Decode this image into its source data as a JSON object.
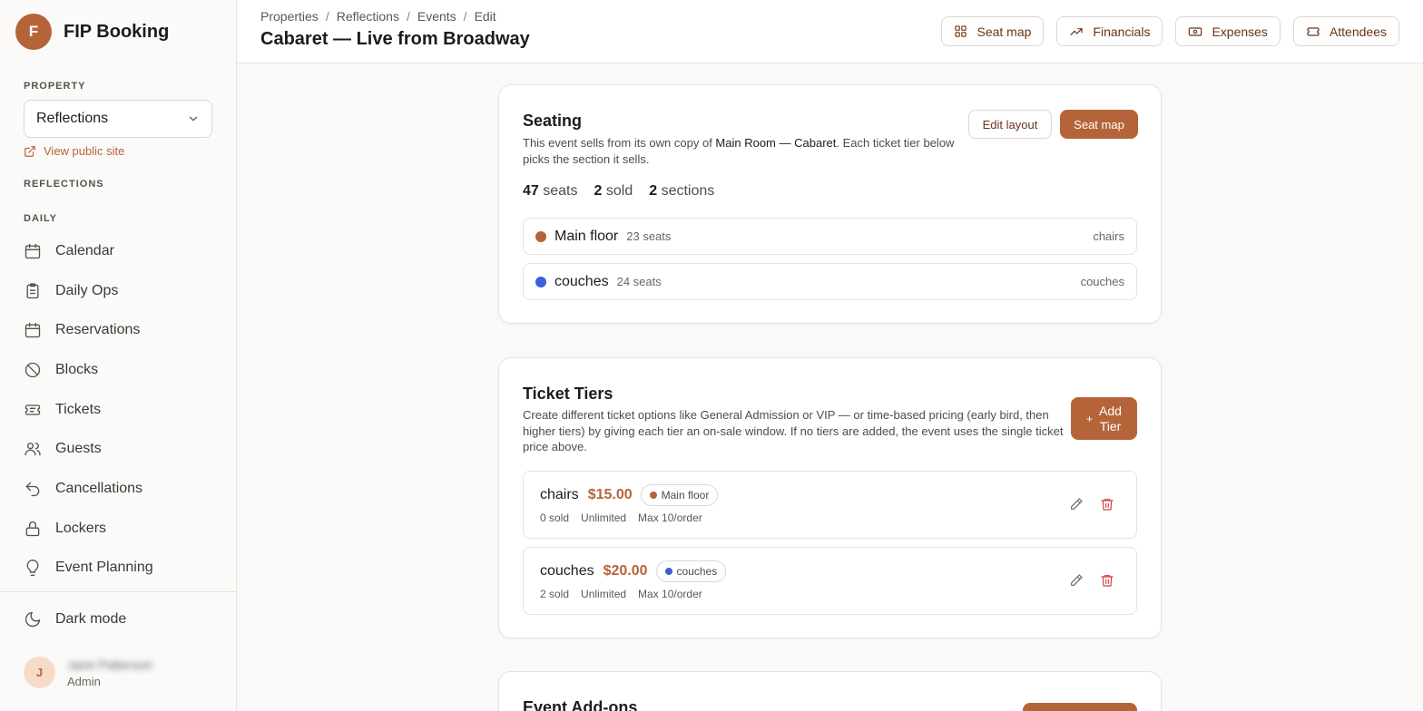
{
  "brand": {
    "initial": "F",
    "name": "FIP Booking"
  },
  "sidebar": {
    "property_label": "PROPERTY",
    "property_value": "Reflections",
    "public_link": "View public site",
    "group_label": "REFLECTIONS",
    "daily_label": "DAILY",
    "items": [
      {
        "label": "Calendar",
        "icon": "calendar-icon"
      },
      {
        "label": "Daily Ops",
        "icon": "clipboard-icon"
      },
      {
        "label": "Reservations",
        "icon": "calendar-icon"
      },
      {
        "label": "Blocks",
        "icon": "ban-icon"
      },
      {
        "label": "Tickets",
        "icon": "ticket-icon"
      },
      {
        "label": "Guests",
        "icon": "users-icon"
      },
      {
        "label": "Cancellations",
        "icon": "undo-icon"
      },
      {
        "label": "Lockers",
        "icon": "lock-icon"
      },
      {
        "label": "Event Planning",
        "icon": "lightbulb-icon"
      }
    ],
    "dark_mode": "Dark mode",
    "user": {
      "initial": "J",
      "name": "Jane Patterson",
      "role": "Admin"
    }
  },
  "header": {
    "breadcrumbs": [
      "Properties",
      "Reflections",
      "Events",
      "Edit"
    ],
    "title": "Cabaret — Live from Broadway",
    "actions": [
      {
        "label": "Seat map",
        "icon": "grid-icon"
      },
      {
        "label": "Financials",
        "icon": "trend-up-icon"
      },
      {
        "label": "Expenses",
        "icon": "banknote-icon"
      },
      {
        "label": "Attendees",
        "icon": "ticket-icon"
      }
    ]
  },
  "seating": {
    "title": "Seating",
    "desc_pre": "This event sells from its own copy of ",
    "desc_bold": "Main Room — Cabaret",
    "desc_post": ". Each ticket tier below picks the section it sells.",
    "edit_layout": "Edit layout",
    "seat_map": "Seat map",
    "stats": [
      {
        "value": "47",
        "label": "seats"
      },
      {
        "value": "2",
        "label": "sold"
      },
      {
        "value": "2",
        "label": "sections"
      }
    ],
    "sections": [
      {
        "name": "Main floor",
        "seats": "23 seats",
        "type": "chairs",
        "color": "#b5643a"
      },
      {
        "name": "couches",
        "seats": "24 seats",
        "type": "couches",
        "color": "#3b5fd6"
      }
    ]
  },
  "tiers": {
    "title": "Ticket Tiers",
    "desc": "Create different ticket options like General Admission or VIP — or time-based pricing (early bird, then higher tiers) by giving each tier an on-sale window. If no tiers are added, the event uses the single ticket price above.",
    "add_label_1": "Add",
    "add_label_2": "Tier",
    "add_plus": "+",
    "items": [
      {
        "name": "chairs",
        "price": "$15.00",
        "section": "Main floor",
        "color": "#b5643a",
        "sold": "0 sold",
        "limit": "Unlimited",
        "max": "Max 10/order"
      },
      {
        "name": "couches",
        "price": "$20.00",
        "section": "couches",
        "color": "#3b5fd6",
        "sold": "2 sold",
        "limit": "Unlimited",
        "max": "Max 10/order"
      }
    ]
  },
  "addons": {
    "title": "Event Add-ons"
  }
}
